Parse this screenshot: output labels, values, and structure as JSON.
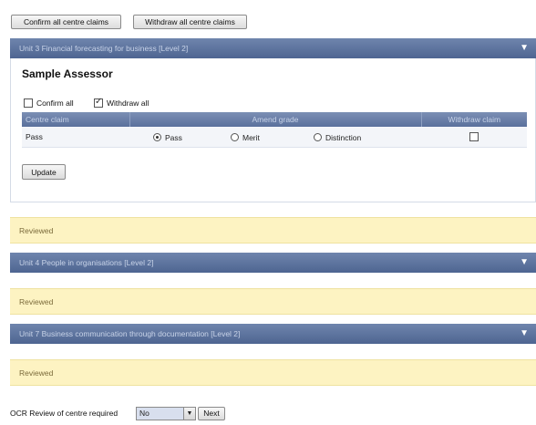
{
  "top_actions": {
    "confirm_all": "Confirm all centre claims",
    "withdraw_all": "Withdraw all centre claims"
  },
  "units": [
    {
      "title": "Unit 3 Financial forecasting for business [Level 2]",
      "assessor": "Sample Assessor",
      "confirm_all_label": "Confirm all",
      "confirm_all_checked": false,
      "withdraw_all_label": "Withdraw all",
      "withdraw_all_checked": true,
      "columns": [
        "Centre claim",
        "Amend grade",
        "Withdraw claim"
      ],
      "rows": [
        {
          "centre_claim": "Pass",
          "grades": [
            "Pass",
            "Merit",
            "Distinction"
          ],
          "selected_grade": "Pass",
          "withdraw": false
        }
      ],
      "update_label": "Update",
      "status": "Reviewed"
    },
    {
      "title": "Unit 4 People in organisations [Level 2]",
      "status": "Reviewed"
    },
    {
      "title": "Unit 7 Business communication through documentation [Level 2]",
      "status": "Reviewed"
    }
  ],
  "toggle_icon": "▼",
  "footer": {
    "label": "OCR Review of centre required",
    "select_value": "No",
    "select_arrow": "▼",
    "next_label": "Next"
  }
}
